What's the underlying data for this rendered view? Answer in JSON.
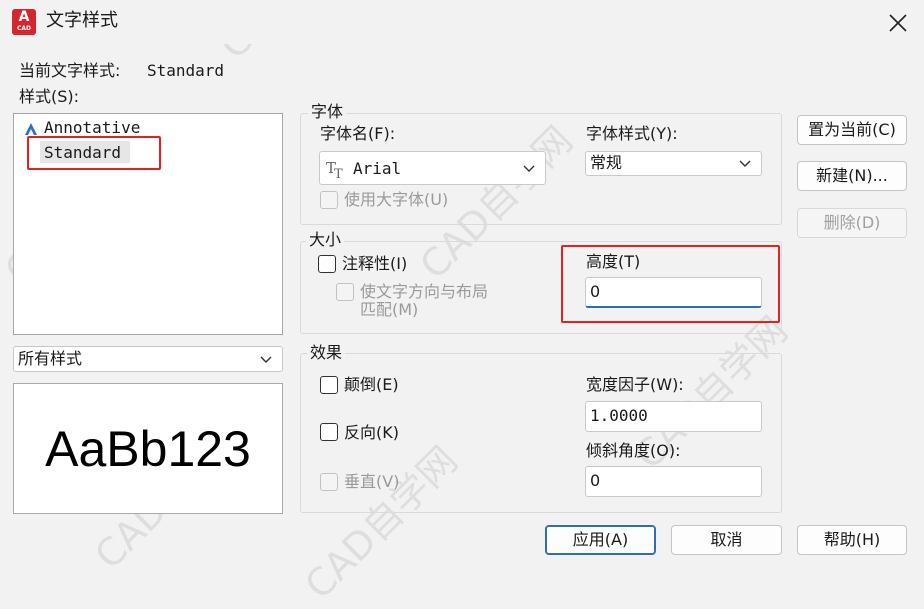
{
  "window": {
    "title": "文字样式",
    "app_icon_big": "A",
    "app_icon_small": "CAD"
  },
  "current_style": {
    "label": "当前文字样式:",
    "value": "Standard"
  },
  "styles": {
    "label": "样式(S):",
    "items": [
      {
        "name": "Annotative",
        "icon": "annotative-icon"
      },
      {
        "name": "Standard",
        "selected": true
      }
    ],
    "filter": "所有样式",
    "preview_text": "AaBb123"
  },
  "font": {
    "group_label": "字体",
    "name_label": "字体名(F):",
    "name_value": "Arial",
    "style_label": "字体样式(Y):",
    "style_value": "常规",
    "bigfont_label": "使用大字体(U)"
  },
  "size": {
    "group_label": "大小",
    "annotative_label": "注释性(I)",
    "match_orientation_label_line1": "使文字方向与布局",
    "match_orientation_label_line2": "匹配(M)",
    "height_label": "高度(T)",
    "height_value": "0"
  },
  "effects": {
    "group_label": "效果",
    "upside_down_label": "颠倒(E)",
    "backwards_label": "反向(K)",
    "vertical_label": "垂直(V)",
    "width_factor_label": "宽度因子(W):",
    "width_factor_value": "1.0000",
    "oblique_label": "倾斜角度(O):",
    "oblique_value": "0"
  },
  "buttons": {
    "set_current": "置为当前(C)",
    "new": "新建(N)...",
    "delete": "删除(D)",
    "apply": "应用(A)",
    "cancel": "取消",
    "help": "帮助(H)"
  },
  "watermark": "CAD自学网",
  "colors": {
    "highlight_red": "#e0241d",
    "accent_blue": "#2f6fb0",
    "icon_red": "#d6262d"
  }
}
